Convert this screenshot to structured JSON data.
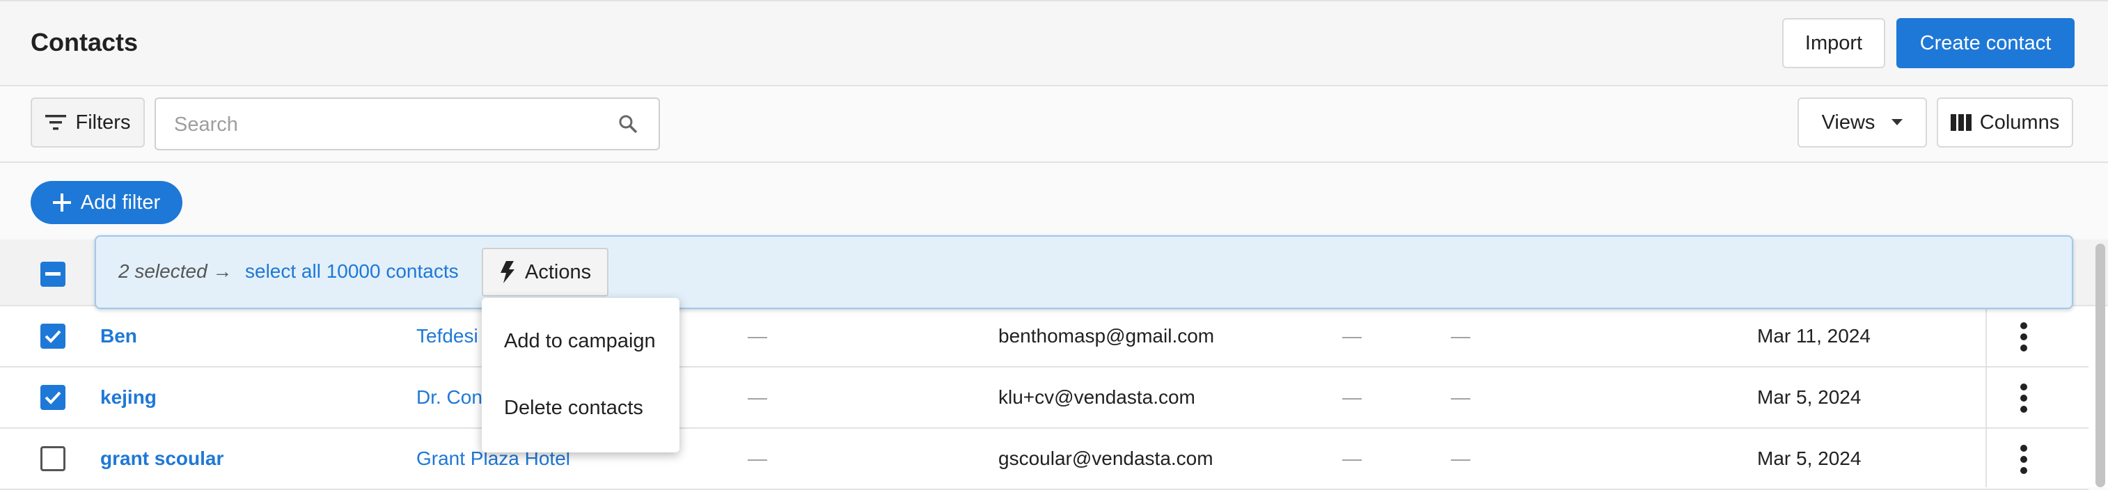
{
  "header": {
    "title": "Contacts",
    "import_label": "Import",
    "create_label": "Create contact"
  },
  "toolbar": {
    "filters_label": "Filters",
    "search_placeholder": "Search",
    "views_label": "Views",
    "columns_label": "Columns"
  },
  "filter_bar": {
    "add_filter_label": "Add filter"
  },
  "selection": {
    "count_text": "2 selected →",
    "select_all_text": "select all 10000 contacts",
    "actions_label": "Actions"
  },
  "actions_menu": {
    "items": [
      "Add to campaign",
      "Delete contacts"
    ]
  },
  "rows": [
    {
      "checked": true,
      "name": "Ben",
      "company": "Tefdesi",
      "col3": "—",
      "email": "benthomasp@gmail.com",
      "col5": "—",
      "col6": "—",
      "date": "Mar 11, 2024"
    },
    {
      "checked": true,
      "name": "kejing",
      "company": "Dr. Con",
      "col3": "—",
      "email": "klu+cv@vendasta.com",
      "col5": "—",
      "col6": "—",
      "date": "Mar 5, 2024"
    },
    {
      "checked": false,
      "name": "grant scoular",
      "company": "Grant Plaza Hotel",
      "col3": "—",
      "email": "gscoular@vendasta.com",
      "col5": "—",
      "col6": "—",
      "date": "Mar 5, 2024"
    }
  ],
  "colors": {
    "accent": "#1e78d7",
    "selection_bg": "#e3f0fa"
  }
}
